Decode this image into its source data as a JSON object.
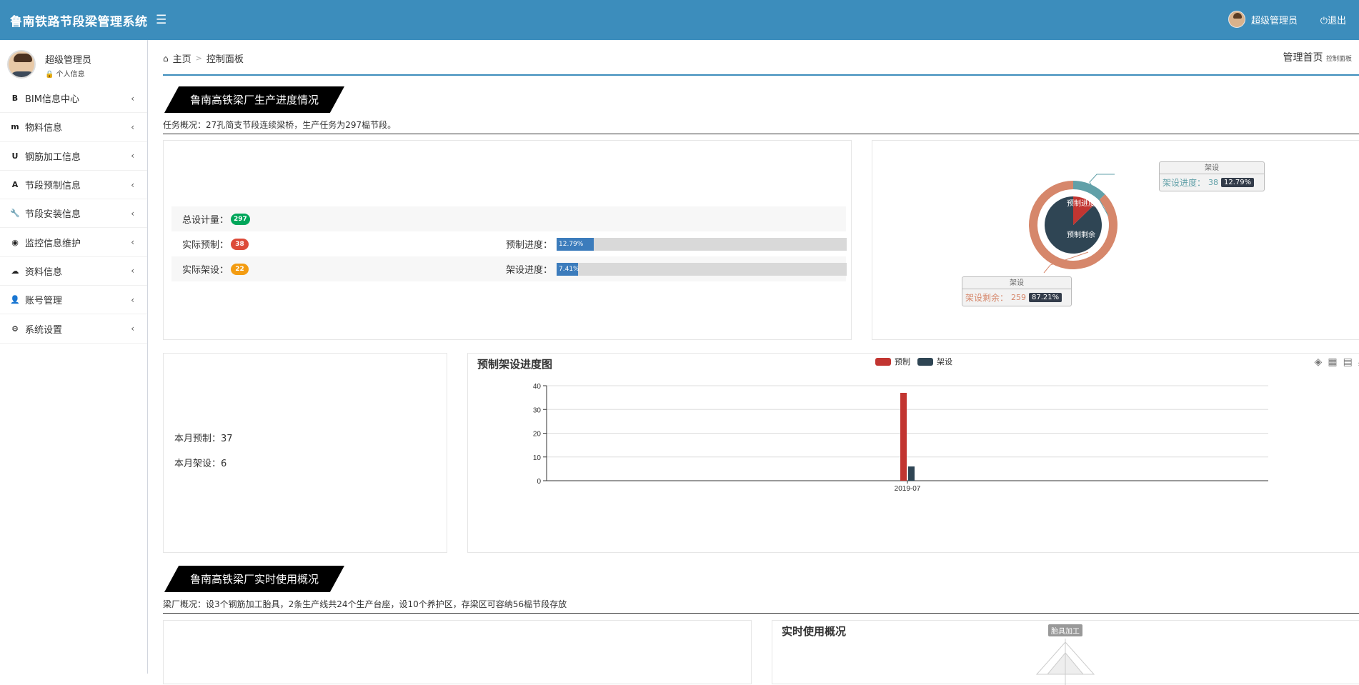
{
  "app": {
    "title": "鲁南铁路节段梁管理系统"
  },
  "topbar": {
    "user_name": "超级管理员",
    "logout_label": "退出"
  },
  "sidebar": {
    "user_name": "超级管理员",
    "user_link": "个人信息",
    "items": [
      {
        "icon": "bold-b-icon",
        "glyph": "B",
        "label": "BIM信息中心"
      },
      {
        "icon": "medium-m-icon",
        "glyph": "m",
        "label": "物料信息"
      },
      {
        "icon": "magnet-icon",
        "glyph": "U",
        "label": "钢筋加工信息"
      },
      {
        "icon": "road-icon",
        "glyph": "A",
        "label": "节段预制信息"
      },
      {
        "icon": "wrench-icon",
        "glyph": "🔧",
        "label": "节段安装信息"
      },
      {
        "icon": "podcast-icon",
        "glyph": "◉",
        "label": "监控信息维护"
      },
      {
        "icon": "cloud-download-icon",
        "glyph": "☁",
        "label": "资料信息"
      },
      {
        "icon": "user-plus-icon",
        "glyph": "👤",
        "label": "账号管理"
      },
      {
        "icon": "cog-icon",
        "glyph": "⚙",
        "label": "系统设置"
      }
    ]
  },
  "breadcrumb": {
    "home": "主页",
    "current": "控制面板"
  },
  "page_header": {
    "title": "管理首页",
    "subtitle": "控制面板"
  },
  "section1": {
    "title": "鲁南高铁梁厂生产进度情况",
    "desc": "任务概况：27孔简支节段连续梁桥，生产任务为297榀节段。",
    "total_label": "总设计量：",
    "total_value": "297",
    "precast_label": "实际预制：",
    "precast_value": "38",
    "erect_label": "实际架设：",
    "erect_value": "22",
    "precast_progress_label": "预制进度：",
    "precast_progress_text": "12.79%",
    "precast_progress": 12.79,
    "erect_progress_label": "架设进度：",
    "erect_progress_text": "7.41%",
    "erect_progress": 7.41,
    "colors": {
      "total": "#00a65a",
      "precast": "#dd4b39",
      "erect": "#f39c12"
    }
  },
  "donut": {
    "inner_labels": {
      "done": "预制进度",
      "remain": "预制剩余"
    },
    "tooltip_top": {
      "head": "架设",
      "label": "架设进度：",
      "value": "38",
      "pct": "12.79%"
    },
    "tooltip_bottom": {
      "head": "架设",
      "label": "架设剩余：",
      "value": "259",
      "pct": "87.21%"
    },
    "colors": {
      "outer_remain": "#d6876b",
      "outer_done": "#61a0a8",
      "inner_remain": "#2f4554",
      "inner_done": "#c23531"
    }
  },
  "month": {
    "precast_label": "本月预制：",
    "precast_value": "37",
    "erect_label": "本月架设：",
    "erect_value": "6"
  },
  "chart_data": {
    "type": "bar",
    "title": "预制架设进度图",
    "categories": [
      "2019-07"
    ],
    "series": [
      {
        "name": "预制",
        "values": [
          37
        ],
        "color": "#c23531"
      },
      {
        "name": "架设",
        "values": [
          6
        ],
        "color": "#2f4554"
      }
    ],
    "ylim": [
      0,
      40
    ],
    "yticks": [
      0,
      10,
      20,
      30,
      40
    ],
    "grid": true,
    "legend": "top"
  },
  "section2": {
    "title": "鲁南高铁梁厂实时使用概况",
    "desc": "梁厂概况：设3个钢筋加工胎具，2条生产线共24个生产台座，设10个养护区，存梁区可容纳56榀节段存放",
    "chart_title": "实时使用概况",
    "radar_label": "胎具加工"
  }
}
